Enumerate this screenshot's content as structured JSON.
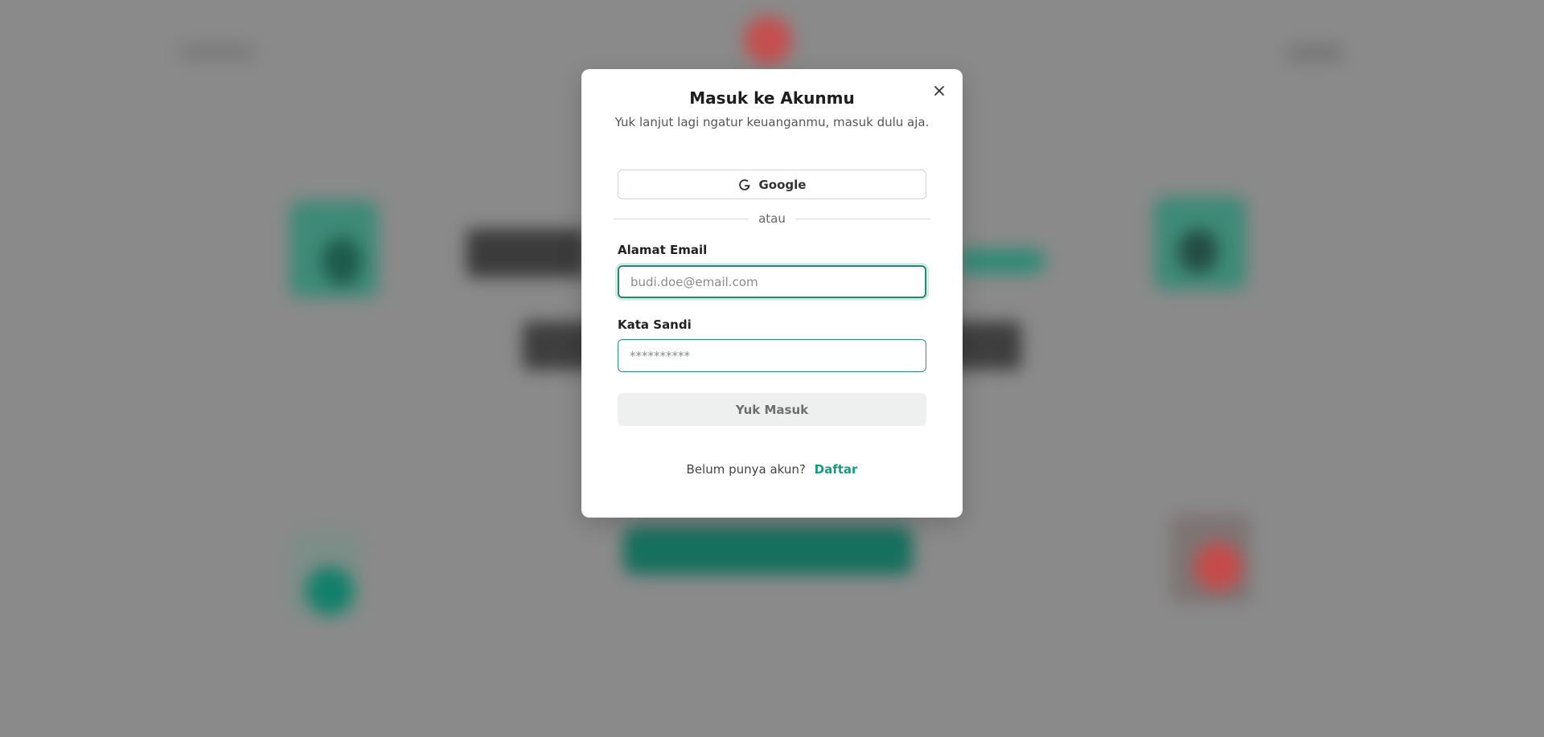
{
  "modal": {
    "title": "Masuk ke Akunmu",
    "subtitle": "Yuk lanjut lagi ngatur keuanganmu, masuk dulu aja.",
    "google_button_label": "Google",
    "divider_text": "atau",
    "email_label": "Alamat Email",
    "email_placeholder": "budi.doe@email.com",
    "email_value": "",
    "password_label": "Kata Sandi",
    "password_placeholder": "**********",
    "password_value": "",
    "submit_label": "Yuk Masuk",
    "footer_text": "Belum punya akun?",
    "register_link": "Daftar",
    "close_icon": "close-icon",
    "google_icon": "google-icon"
  },
  "colors": {
    "accent": "#1f8a75",
    "link": "#1a9a80",
    "overlay": "#8a8a8a",
    "submit_disabled_bg": "#eef0ef"
  }
}
